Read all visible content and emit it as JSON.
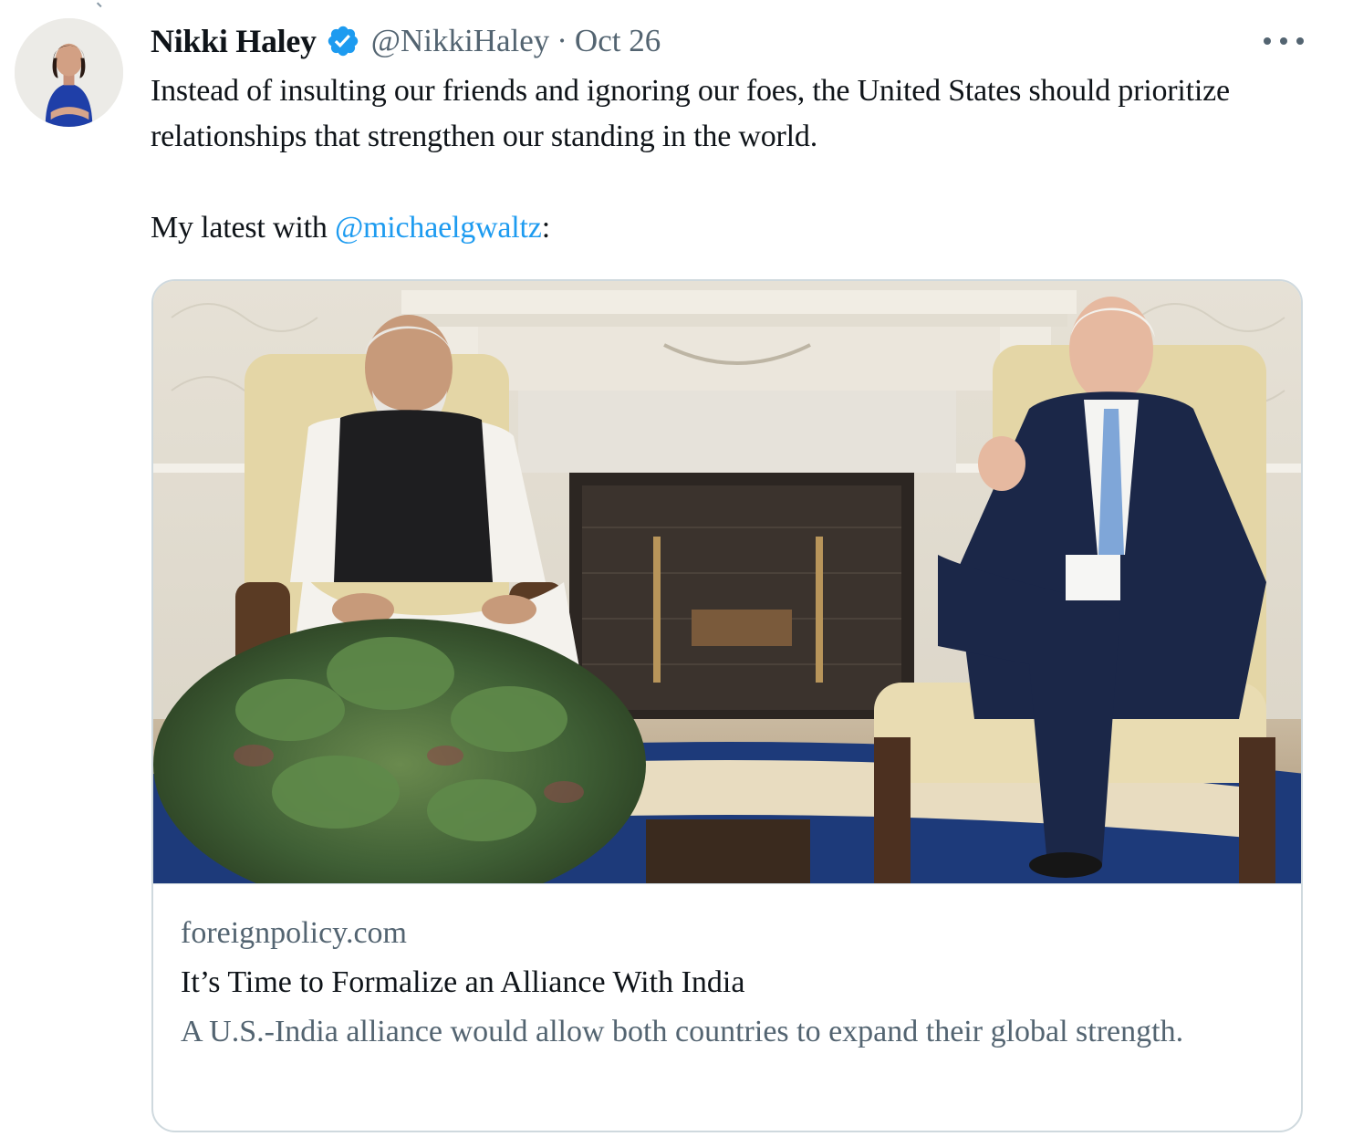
{
  "tweet": {
    "author": {
      "display_name": "Nikki Haley",
      "verified": true,
      "handle": "@NikkiHaley",
      "avatar_icon": "profile-photo"
    },
    "separator": "·",
    "date": "Oct 26",
    "more_icon": "more-horizontal-icon",
    "text_line1": "Instead of insulting our friends and ignoring our foes, the United States should prioritize relationships that strengthen our standing in the world.",
    "text_line2_prefix": "My latest with ",
    "mention": "@michaelgwaltz",
    "text_line2_suffix": ":"
  },
  "card": {
    "image_icon": "article-thumbnail-photo",
    "domain": "foreignpolicy.com",
    "title": "It’s Time to Formalize an Alliance With India",
    "description": "A U.S.-India alliance would allow both countries to expand their global strength."
  },
  "colors": {
    "link_blue": "#1d9bf0",
    "verified_blue": "#1d9bf0",
    "secondary_text": "#536471",
    "primary_text": "#0f1419",
    "border": "#cfd9de"
  }
}
